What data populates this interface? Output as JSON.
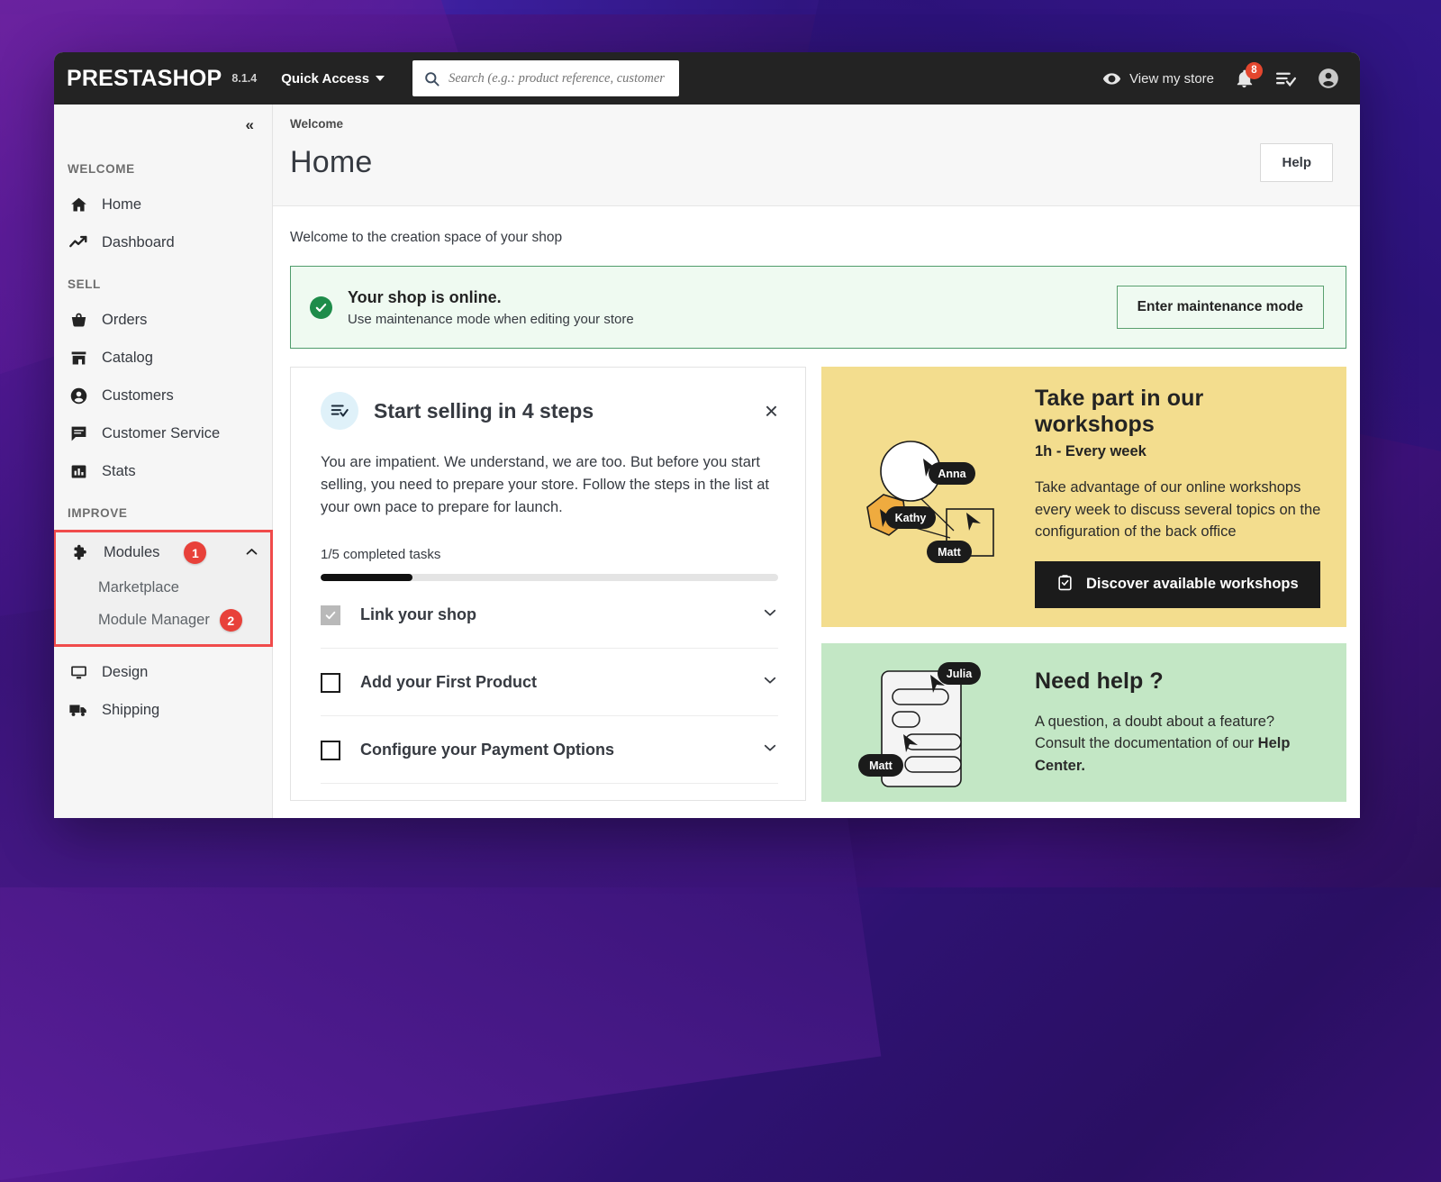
{
  "navbar": {
    "brand": "PRESTASHOP",
    "version": "8.1.4",
    "quick_access": "Quick Access",
    "search_placeholder": "Search (e.g.: product reference, customer name...)",
    "search_value": "",
    "view_store": "View my store",
    "notification_count": "8",
    "icons": {
      "search": "search-icon",
      "eye": "eye-icon",
      "bell": "bell-icon",
      "tasks": "tasks-checklist-icon",
      "account": "account-circle-icon"
    }
  },
  "sidebar": {
    "collapse_label": "«",
    "sections": [
      {
        "title": "WELCOME",
        "items": [
          {
            "label": "Home",
            "icon": "home-icon"
          },
          {
            "label": "Dashboard",
            "icon": "trending-up-icon"
          }
        ]
      },
      {
        "title": "SELL",
        "items": [
          {
            "label": "Orders",
            "icon": "basket-icon"
          },
          {
            "label": "Catalog",
            "icon": "store-icon"
          },
          {
            "label": "Customers",
            "icon": "person-circle-icon"
          },
          {
            "label": "Customer Service",
            "icon": "chat-icon"
          },
          {
            "label": "Stats",
            "icon": "bar-chart-icon"
          }
        ]
      },
      {
        "title": "IMPROVE",
        "items": []
      }
    ],
    "modules": {
      "label": "Modules",
      "icon": "puzzle-icon",
      "badge": "1",
      "expanded": true,
      "children": [
        {
          "label": "Marketplace",
          "badge": ""
        },
        {
          "label": "Module Manager",
          "badge": "2"
        }
      ]
    },
    "after_modules": [
      {
        "label": "Design",
        "icon": "monitor-icon"
      },
      {
        "label": "Shipping",
        "icon": "truck-icon"
      }
    ],
    "highlight_color": "#f04b4b"
  },
  "page": {
    "breadcrumb": "Welcome",
    "title": "Home",
    "help_button": "Help",
    "welcome_line": "Welcome to the creation space of your shop"
  },
  "alert": {
    "title": "Your shop is online.",
    "subtitle": "Use maintenance mode when editing your store",
    "button": "Enter maintenance mode",
    "icon": "check-circle-icon",
    "bg": "#effaf1",
    "border": "#4f9c6b",
    "icon_bg": "#1e8c4a"
  },
  "onboarding": {
    "icon": "checklist-icon",
    "title": "Start selling in 4 steps",
    "close": "×",
    "text": "You are impatient. We understand, we are too. But before you start selling, you need to prepare your store. Follow the steps in the list at your own pace to prepare for launch.",
    "progress_label": "1/5 completed tasks",
    "progress_percent": 20,
    "tasks": [
      {
        "label": "Link your shop",
        "done": true
      },
      {
        "label": "Add your First Product",
        "done": false
      },
      {
        "label": "Configure your Payment Options",
        "done": false
      }
    ]
  },
  "workshops": {
    "title": "Take part in our workshops",
    "subtitle": "1h - Every week",
    "text": "Take advantage of our online workshops every week to discuss several topics on the configuration of the back office",
    "button": "Discover available workshops",
    "button_icon": "clipboard-check-icon",
    "bg": "#f3dd8e",
    "art_labels": [
      "Anna",
      "Kathy",
      "Matt"
    ]
  },
  "need_help": {
    "title": "Need help ?",
    "text_1": "A question, a doubt about a feature? Consult the documentation of our ",
    "text_bold": "Help Center.",
    "bg": "#c3e7c5",
    "art_labels": [
      "Julia",
      "Matt"
    ]
  }
}
